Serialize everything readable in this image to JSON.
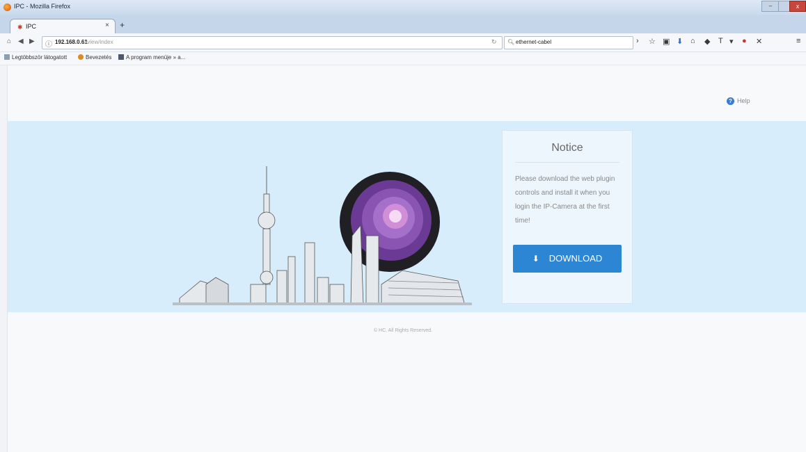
{
  "window": {
    "title": "IPC - Mozilla Firefox",
    "min_label": "",
    "close_label": "x"
  },
  "tabs": [
    {
      "title": "IPC",
      "active": true
    }
  ],
  "newtab_label": "+",
  "navbar": {
    "url_host": "192.168.0.61",
    "url_path": "/view/index",
    "search_text": "ethernet-cabel"
  },
  "bookmarks": [
    {
      "label": "Legtöbbször látogatott"
    },
    {
      "label": "Bevezetés"
    },
    {
      "label": "A program menüje » a..."
    }
  ],
  "page": {
    "help_label": "Help",
    "notice": {
      "title": "Notice",
      "text": "Please download the web plugin controls and install it when you login the IP-Camera at the first time!",
      "download_label": "DOWNLOAD"
    },
    "footer": "© HC. All Rights Reserved."
  },
  "colors": {
    "banner": "#d8edfb",
    "button": "#2c86d3"
  }
}
